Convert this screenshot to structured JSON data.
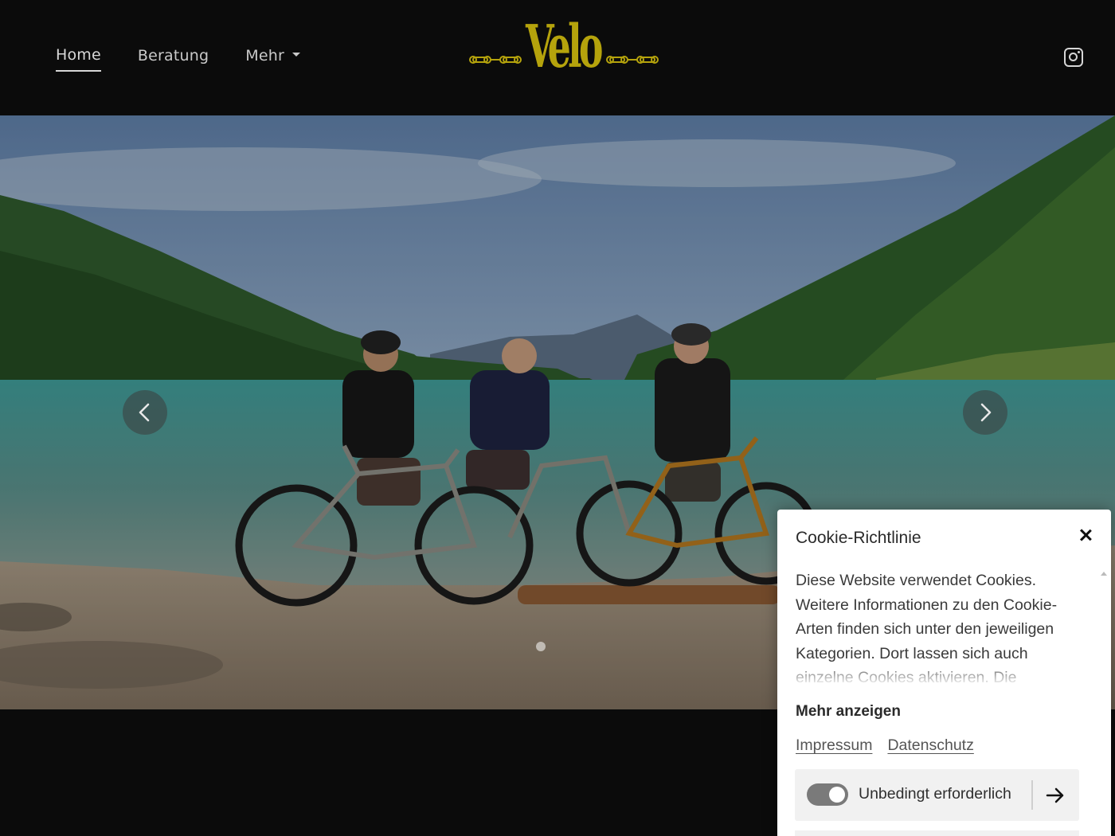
{
  "nav": {
    "items": [
      {
        "label": "Home",
        "active": true
      },
      {
        "label": "Beratung",
        "active": false
      },
      {
        "label": "Mehr",
        "active": false,
        "has_dropdown": true
      }
    ]
  },
  "logo": {
    "text": "Velo",
    "color": "#b5a30c"
  },
  "social": {
    "icon": "instagram-icon"
  },
  "carousel": {
    "prev_icon": "chevron-left-icon",
    "next_icon": "chevron-right-icon",
    "slide_count": 1,
    "current_slide": 1
  },
  "cookie": {
    "title": "Cookie-Richtlinie",
    "body": "Diese Website verwendet Cookies. Weitere Informationen zu den Cookie-Arten finden sich unter den jeweiligen Kategorien. Dort lassen sich auch einzelne Cookies aktivieren. Die",
    "more_label": "Mehr anzeigen",
    "links": [
      "Impressum",
      "Datenschutz"
    ],
    "category": {
      "label": "Unbedingt erforderlich",
      "enabled": true
    }
  }
}
